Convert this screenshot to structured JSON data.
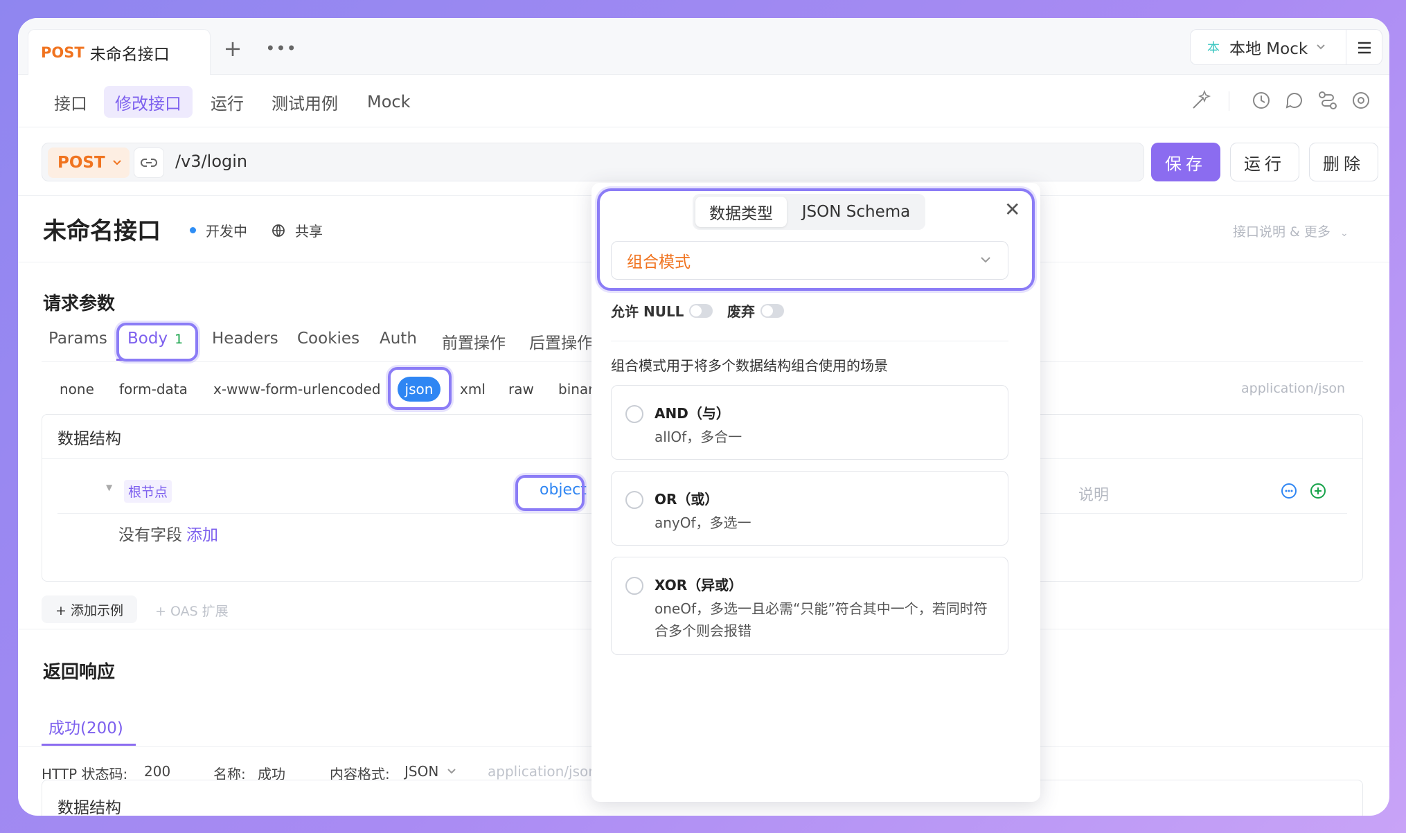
{
  "tabbar": {
    "method": "POST",
    "title": "未命名接口",
    "env_prefix": "本",
    "env_label": "本地 Mock"
  },
  "subnav": {
    "items": [
      "接口",
      "修改接口",
      "运行",
      "测试用例",
      "Mock"
    ],
    "active": "修改接口"
  },
  "url": {
    "method": "POST",
    "path": "/v3/login"
  },
  "actions": {
    "save": "保存",
    "run": "运行",
    "delete": "删除"
  },
  "api": {
    "title": "未命名接口",
    "status": "开发中",
    "share": "共享",
    "more": "接口说明 & 更多"
  },
  "request": {
    "title": "请求参数",
    "tabs": [
      "Params",
      "Body",
      "Headers",
      "Cookies",
      "Auth",
      "前置操作",
      "后置操作"
    ],
    "body_count": "1",
    "content_types": [
      "none",
      "form-data",
      "x-www-form-urlencoded",
      "json",
      "xml",
      "raw",
      "binar"
    ],
    "content_type_hint": "application/json",
    "ds_title": "数据结构",
    "root_label": "根节点",
    "root_type": "object",
    "note_label": "说明",
    "no_field": "没有字段",
    "add": "添加",
    "add_example": "+ 添加示例",
    "oas": "+ OAS 扩展"
  },
  "response": {
    "title": "返回响应",
    "tab": "成功(200)",
    "status_label": "HTTP 状态码:",
    "status_value": "200",
    "name_label": "名称:",
    "name_value": "成功",
    "format_label": "内容格式:",
    "format_value": "JSON",
    "format_hint": "application/json",
    "ds_title": "数据结构"
  },
  "popover": {
    "seg_tabs": [
      "数据类型",
      "JSON Schema"
    ],
    "mode": "组合模式",
    "allow_null": "允许 NULL",
    "deprecated": "废弃",
    "desc": "组合模式用于将多个数据结构组合使用的场景",
    "options": [
      {
        "title": "AND（与）",
        "sub": "allOf，多合一"
      },
      {
        "title": "OR（或）",
        "sub": "anyOf，多选一"
      },
      {
        "title": "XOR（异或）",
        "sub": "oneOf，多选一且必需“只能”符合其中一个，若同时符合多个则会报错"
      }
    ]
  }
}
